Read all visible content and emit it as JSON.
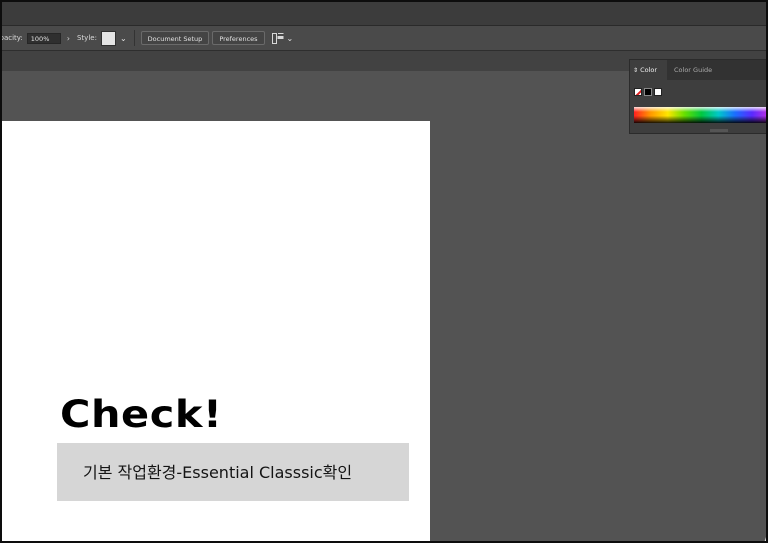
{
  "control_bar": {
    "opacity_label": "Opacity:",
    "opacity_value": "100%",
    "style_label": "Style:",
    "document_setup": "Document Setup",
    "preferences": "Preferences",
    "icons": [
      "chevron-right-icon",
      "chevron-down-icon",
      "arrange-icon"
    ]
  },
  "color_panel": {
    "tabs": [
      "Color",
      "Color Guide"
    ],
    "swatches": [
      "none",
      "black",
      "white"
    ]
  },
  "artboard": {
    "headline": "Check!",
    "subtitle": "기본 작업환경-Essential Classsic확인"
  },
  "colors": {
    "workspace": "#535353",
    "artboard": "#ffffff",
    "subtitle_box": "#d6d6d6"
  }
}
